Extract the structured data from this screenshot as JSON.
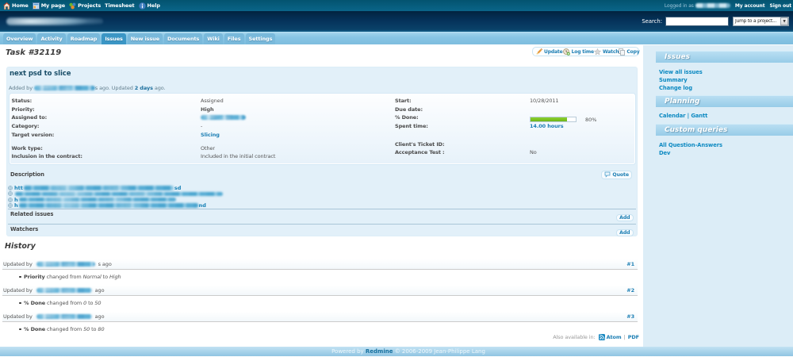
{
  "colors": {
    "link_blue": "#1D7FB4",
    "sidebar_link_blue": "#0E8AC2",
    "progress_green": "#7CC41E",
    "topbar_bg": "#075C7F",
    "header_bg": "#07365C",
    "tabbar_bg": "#87C5E4",
    "active_tab": "#3B96C5",
    "sidebar_bg": "#DCEDF7",
    "issue_box_bg": "#E2F0F9"
  },
  "topbar": {
    "items": [
      {
        "label": "Home",
        "icon": "home-icon"
      },
      {
        "label": "My page",
        "icon": "my-page-icon"
      },
      {
        "label": "Projects",
        "icon": "projects-icon"
      },
      {
        "label": "Timesheet",
        "icon": ""
      },
      {
        "label": "Help",
        "icon": "help-icon"
      }
    ],
    "logged_in_prefix": "Logged in as",
    "my_account": "My account",
    "sign_out": "Sign out"
  },
  "header": {
    "search_label": "Search:",
    "search_value": "",
    "project_select": "Jump to a project..."
  },
  "tabs": [
    {
      "label": "Overview",
      "active": false
    },
    {
      "label": "Activity",
      "active": false
    },
    {
      "label": "Roadmap",
      "active": false
    },
    {
      "label": "Issues",
      "active": true
    },
    {
      "label": "New issue",
      "active": false
    },
    {
      "label": "Documents",
      "active": false
    },
    {
      "label": "Wiki",
      "active": false
    },
    {
      "label": "Files",
      "active": false
    },
    {
      "label": "Settings",
      "active": false
    }
  ],
  "page_title": "Task #32119",
  "toolbar": {
    "update": "Update",
    "log_time": "Log time",
    "watch": "Watch",
    "copy": "Copy"
  },
  "issue": {
    "title": "next psd to slice",
    "added_prefix": "Added by",
    "added_mid": "s ago. Updated",
    "updated_link": "2 days",
    "added_suffix": "ago.",
    "attrs_left": [
      {
        "label": "Status:",
        "value": "Assigned",
        "style": "plain"
      },
      {
        "label": "Priority:",
        "value": "High",
        "style": "bold"
      },
      {
        "label": "Assigned to:",
        "value": "",
        "style": "censored"
      },
      {
        "label": "Category:",
        "value": "-",
        "style": "plain"
      },
      {
        "label": "Target version:",
        "value": "Slicing",
        "style": "link"
      },
      {
        "label": "Work type:",
        "value": "Other",
        "style": "plain"
      },
      {
        "label": "Inclusion in the contract:",
        "value": "Included in the initial contract",
        "style": "plain"
      }
    ],
    "attrs_right": [
      {
        "label": "Start:",
        "value": "10/28/2011",
        "style": "plain"
      },
      {
        "label": "Due date:",
        "value": "",
        "style": "plain"
      },
      {
        "label": "% Done:",
        "value": "80%",
        "style": "progress"
      },
      {
        "label": "Spent time:",
        "value": "14.00 hours",
        "style": "link"
      },
      {
        "label": "Client's Ticket ID:",
        "value": "",
        "style": "plain"
      },
      {
        "label": "Acceptance Test :",
        "value": "No",
        "style": "plain"
      }
    ],
    "done_pct": 80,
    "done_label": "80%"
  },
  "sections": {
    "description": {
      "title": "Description",
      "quote_label": "Quote",
      "links": [
        {
          "head": "htt",
          "tail": "sd"
        },
        {
          "head": "",
          "tail": ""
        },
        {
          "head": "h",
          "tail": ""
        },
        {
          "head": "h",
          "tail": "nd"
        }
      ]
    },
    "related": {
      "title": "Related issues",
      "add_label": "Add"
    },
    "watchers": {
      "title": "Watchers",
      "add_label": "Add"
    }
  },
  "history": {
    "title": "History",
    "entries": [
      {
        "prefix": "Updated by",
        "suffix": "s ago",
        "num": "#1",
        "field": "Priority",
        "mid1": "changed from",
        "from": "Normal",
        "mid2": "to",
        "to": "High"
      },
      {
        "prefix": "Updated by",
        "suffix": "ago",
        "num": "#2",
        "field": "% Done",
        "mid1": "changed from",
        "from": "0",
        "mid2": "to",
        "to": "50"
      },
      {
        "prefix": "Updated by",
        "suffix": "ago",
        "num": "#3",
        "field": "% Done",
        "mid1": "changed from",
        "from": "50",
        "mid2": "to",
        "to": "80"
      }
    ]
  },
  "other_formats": {
    "label": "Also available in:",
    "atom": "Atom",
    "sep": "|",
    "pdf": "PDF"
  },
  "footer": {
    "powered_by": "Powered by",
    "redmine": "Redmine",
    "copyright": "© 2006-2009 Jean-Philippe Lang"
  },
  "sidebar": {
    "groups": [
      {
        "title": "Issues",
        "links": [
          "View all issues",
          "Summary",
          "Change log"
        ]
      },
      {
        "title": "Planning",
        "links": [
          "Calendar",
          "Gantt"
        ],
        "inline_sep": "|"
      },
      {
        "title": "Custom queries",
        "links": [
          "All Question-Answers",
          "Dev"
        ]
      }
    ]
  }
}
